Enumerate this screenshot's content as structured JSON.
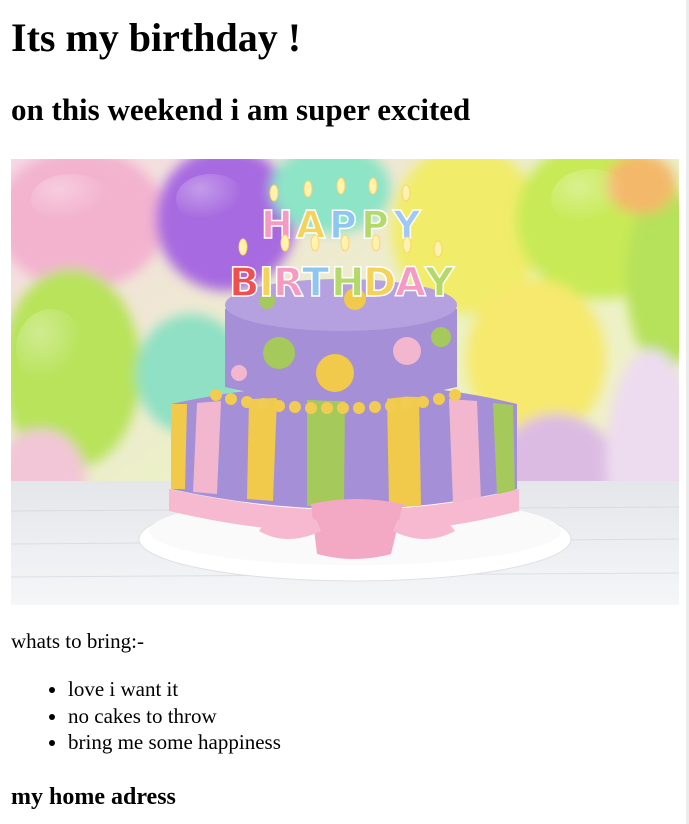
{
  "page": {
    "title": "Its my birthday !",
    "subtitle": "on this weekend i am super excited",
    "hero_image": {
      "kind": "birthday-cake-photo",
      "candle_letters_top": "HAPPY",
      "candle_letters_bottom": "BIRTHDAY",
      "colors": {
        "cake_purple": "#a58fd6",
        "stripe_yellow": "#f1c94b",
        "stripe_green": "#a6c95c",
        "stripe_pink": "#f3b6cf",
        "ribbon_pink": "#f6b9cf"
      }
    },
    "bring_heading": "whats to bring:-",
    "bring_items": [
      "love i want it",
      "no cakes to throw",
      "bring me some happiness"
    ],
    "address_heading": "my home adress"
  }
}
